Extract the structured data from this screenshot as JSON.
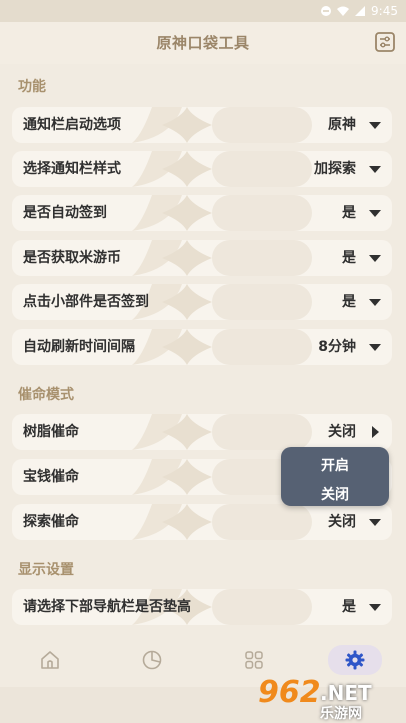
{
  "status_bar": {
    "time": "9:45"
  },
  "header": {
    "title": "原神口袋工具",
    "menu_icon": "list-toggle-icon"
  },
  "sections": [
    {
      "title": "功能"
    },
    {
      "title": "催命模式"
    },
    {
      "title": "显示设置"
    }
  ],
  "rows": [
    {
      "label": "通知栏启动选项",
      "value": "原神"
    },
    {
      "label": "选择通知栏样式",
      "value": "加探索"
    },
    {
      "label": "是否自动签到",
      "value": "是"
    },
    {
      "label": "是否获取米游币",
      "value": "是"
    },
    {
      "label": "点击小部件是否签到",
      "value": "是"
    },
    {
      "label": "自动刷新时间间隔",
      "value": "8分钟"
    },
    {
      "label": "树脂催命",
      "value": "关闭"
    },
    {
      "label": "宝钱催命",
      "value": ""
    },
    {
      "label": "探索催命",
      "value": "关闭"
    },
    {
      "label": "请选择下部导航栏是否垫高",
      "value": "是"
    }
  ],
  "popup": {
    "options": [
      "开启",
      "关闭"
    ]
  },
  "bottom_nav": {
    "items": [
      {
        "icon": "home-icon"
      },
      {
        "icon": "pie-chart-icon"
      },
      {
        "icon": "grid-icon"
      },
      {
        "icon": "gear-icon",
        "active": true
      }
    ]
  },
  "watermark": {
    "number": "962",
    "suffix": ".NET",
    "site": "乐游网"
  },
  "colors": {
    "accent": "#a8916e",
    "popup_bg": "#566173",
    "active_nav": "#e6dfeb",
    "gear": "#2f56c8"
  }
}
